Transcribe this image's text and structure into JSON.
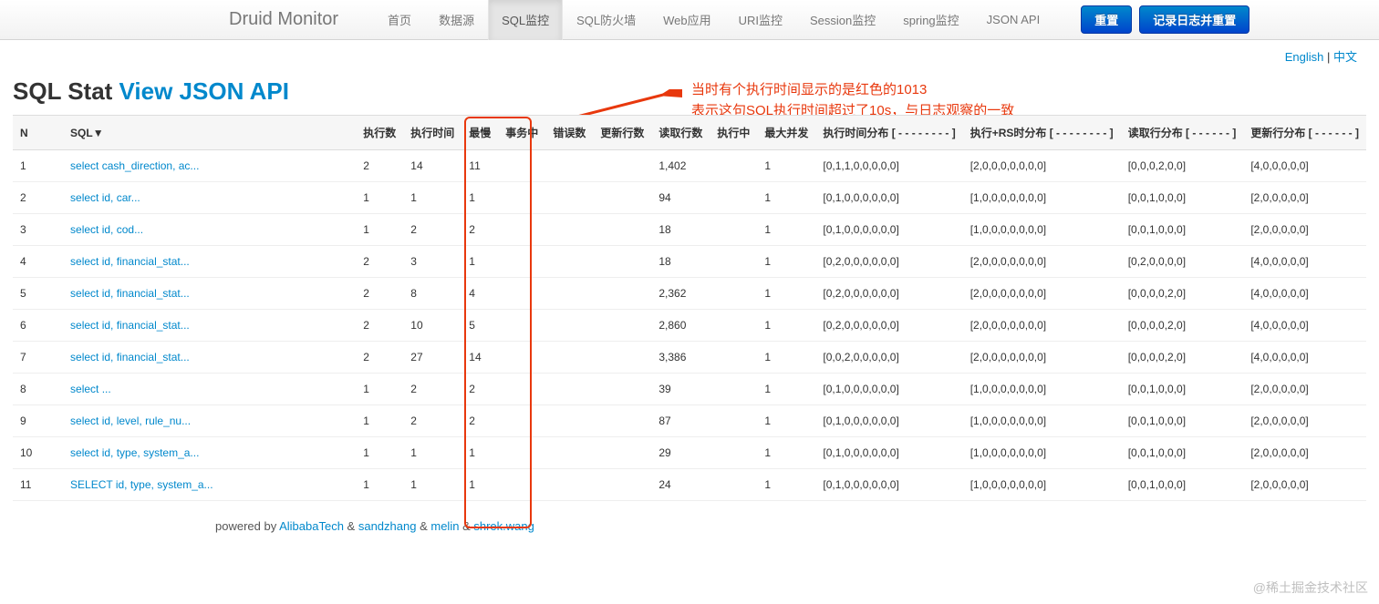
{
  "brand": "Druid Monitor",
  "nav": {
    "items": [
      "首页",
      "数据源",
      "SQL监控",
      "SQL防火墙",
      "Web应用",
      "URI监控",
      "Session监控",
      "spring监控",
      "JSON API"
    ],
    "active_index": 2,
    "btn_reset": "重置",
    "btn_log_reset": "记录日志并重置"
  },
  "lang": {
    "en": "English",
    "zh": "中文"
  },
  "title": {
    "main": "SQL Stat ",
    "link": "View JSON API"
  },
  "annotation": {
    "line1": "当时有个执行时间显示的是红色的1013",
    "line2": "表示这句SQL执行时间超过了10s，与日志观察的一致"
  },
  "table": {
    "headers": [
      "N",
      "SQL▼",
      "执行数",
      "执行时间",
      "最慢",
      "事务中",
      "错误数",
      "更新行数",
      "读取行数",
      "执行中",
      "最大并发",
      "执行时间分布 [ - - - - - - - - ]",
      "执行+RS时分布 [ - - - - - - - - ]",
      "读取行分布 [ - - - - - - ]",
      "更新行分布 [ - - - - - - ]"
    ],
    "rows": [
      {
        "n": "1",
        "sql": "select cash_direction, ac...",
        "exec": "2",
        "time": "14",
        "slow": "11",
        "tx": "",
        "err": "",
        "upd": "",
        "read": "1,402",
        "ing": "",
        "maxc": "1",
        "d1": "[0,1,1,0,0,0,0,0]",
        "d2": "[2,0,0,0,0,0,0,0]",
        "d3": "[0,0,0,2,0,0]",
        "d4": "[4,0,0,0,0,0]"
      },
      {
        "n": "2",
        "sql": "select id, car...",
        "exec": "1",
        "time": "1",
        "slow": "1",
        "tx": "",
        "err": "",
        "upd": "",
        "read": "94",
        "ing": "",
        "maxc": "1",
        "d1": "[0,1,0,0,0,0,0,0]",
        "d2": "[1,0,0,0,0,0,0,0]",
        "d3": "[0,0,1,0,0,0]",
        "d4": "[2,0,0,0,0,0]"
      },
      {
        "n": "3",
        "sql": "select id, cod...",
        "exec": "1",
        "time": "2",
        "slow": "2",
        "tx": "",
        "err": "",
        "upd": "",
        "read": "18",
        "ing": "",
        "maxc": "1",
        "d1": "[0,1,0,0,0,0,0,0]",
        "d2": "[1,0,0,0,0,0,0,0]",
        "d3": "[0,0,1,0,0,0]",
        "d4": "[2,0,0,0,0,0]"
      },
      {
        "n": "4",
        "sql": "select id, financial_stat...",
        "exec": "2",
        "time": "3",
        "slow": "1",
        "tx": "",
        "err": "",
        "upd": "",
        "read": "18",
        "ing": "",
        "maxc": "1",
        "d1": "[0,2,0,0,0,0,0,0]",
        "d2": "[2,0,0,0,0,0,0,0]",
        "d3": "[0,2,0,0,0,0]",
        "d4": "[4,0,0,0,0,0]"
      },
      {
        "n": "5",
        "sql": "select id, financial_stat...",
        "exec": "2",
        "time": "8",
        "slow": "4",
        "tx": "",
        "err": "",
        "upd": "",
        "read": "2,362",
        "ing": "",
        "maxc": "1",
        "d1": "[0,2,0,0,0,0,0,0]",
        "d2": "[2,0,0,0,0,0,0,0]",
        "d3": "[0,0,0,0,2,0]",
        "d4": "[4,0,0,0,0,0]"
      },
      {
        "n": "6",
        "sql": "select id, financial_stat...",
        "exec": "2",
        "time": "10",
        "slow": "5",
        "tx": "",
        "err": "",
        "upd": "",
        "read": "2,860",
        "ing": "",
        "maxc": "1",
        "d1": "[0,2,0,0,0,0,0,0]",
        "d2": "[2,0,0,0,0,0,0,0]",
        "d3": "[0,0,0,0,2,0]",
        "d4": "[4,0,0,0,0,0]"
      },
      {
        "n": "7",
        "sql": "select id, financial_stat...",
        "exec": "2",
        "time": "27",
        "slow": "14",
        "tx": "",
        "err": "",
        "upd": "",
        "read": "3,386",
        "ing": "",
        "maxc": "1",
        "d1": "[0,0,2,0,0,0,0,0]",
        "d2": "[2,0,0,0,0,0,0,0]",
        "d3": "[0,0,0,0,2,0]",
        "d4": "[4,0,0,0,0,0]"
      },
      {
        "n": "8",
        "sql": "select ...",
        "exec": "1",
        "time": "2",
        "slow": "2",
        "tx": "",
        "err": "",
        "upd": "",
        "read": "39",
        "ing": "",
        "maxc": "1",
        "d1": "[0,1,0,0,0,0,0,0]",
        "d2": "[1,0,0,0,0,0,0,0]",
        "d3": "[0,0,1,0,0,0]",
        "d4": "[2,0,0,0,0,0]"
      },
      {
        "n": "9",
        "sql": "select id, level, rule_nu...",
        "exec": "1",
        "time": "2",
        "slow": "2",
        "tx": "",
        "err": "",
        "upd": "",
        "read": "87",
        "ing": "",
        "maxc": "1",
        "d1": "[0,1,0,0,0,0,0,0]",
        "d2": "[1,0,0,0,0,0,0,0]",
        "d3": "[0,0,1,0,0,0]",
        "d4": "[2,0,0,0,0,0]"
      },
      {
        "n": "10",
        "sql": "select id, type, system_a...",
        "exec": "1",
        "time": "1",
        "slow": "1",
        "tx": "",
        "err": "",
        "upd": "",
        "read": "29",
        "ing": "",
        "maxc": "1",
        "d1": "[0,1,0,0,0,0,0,0]",
        "d2": "[1,0,0,0,0,0,0,0]",
        "d3": "[0,0,1,0,0,0]",
        "d4": "[2,0,0,0,0,0]"
      },
      {
        "n": "11",
        "sql": "SELECT id, type, system_a...",
        "exec": "1",
        "time": "1",
        "slow": "1",
        "tx": "",
        "err": "",
        "upd": "",
        "read": "24",
        "ing": "",
        "maxc": "1",
        "d1": "[0,1,0,0,0,0,0,0]",
        "d2": "[1,0,0,0,0,0,0,0]",
        "d3": "[0,0,1,0,0,0]",
        "d4": "[2,0,0,0,0,0]"
      }
    ]
  },
  "footer": {
    "prefix": "powered by ",
    "links": [
      "AlibabaTech",
      "sandzhang",
      "melin",
      "shrek.wang"
    ],
    "sep": " & "
  },
  "watermark": "@稀土掘金技术社区"
}
